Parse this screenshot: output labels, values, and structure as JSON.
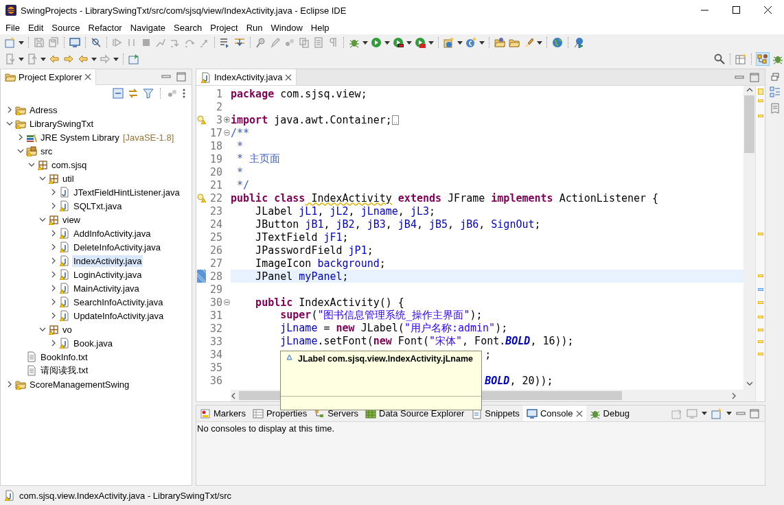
{
  "window": {
    "title": "SwingProjects - LibrarySwingTxt/src/com/sjsq/view/IndexActivity.java - Eclipse IDE"
  },
  "menu": [
    "File",
    "Edit",
    "Source",
    "Refactor",
    "Navigate",
    "Search",
    "Project",
    "Run",
    "Window",
    "Help"
  ],
  "explorer": {
    "title": "Project Explorer",
    "tree": [
      {
        "label": "Adress",
        "kind": "project",
        "warning": true,
        "expanded": false,
        "selected": false
      },
      {
        "label": "LibrarySwingTxt",
        "kind": "project",
        "warning": true,
        "expanded": true,
        "selected": false,
        "children": [
          {
            "label": "JRE System Library",
            "decoration": "[JavaSE-1.8]",
            "kind": "library",
            "warning": false,
            "expanded": false,
            "selected": false
          },
          {
            "label": "src",
            "kind": "source",
            "warning": true,
            "expanded": true,
            "selected": false,
            "children": [
              {
                "label": "com.sjsq",
                "kind": "package",
                "warning": true,
                "expanded": true,
                "selected": false,
                "children": [
                  {
                    "label": "util",
                    "kind": "package",
                    "warning": true,
                    "expanded": true,
                    "selected": false,
                    "children": [
                      {
                        "label": "JTextFieldHintListener.java",
                        "kind": "java",
                        "warning": false,
                        "expanded": false,
                        "selected": false
                      },
                      {
                        "label": "SQLTxt.java",
                        "kind": "java",
                        "warning": true,
                        "expanded": false,
                        "selected": false
                      }
                    ]
                  },
                  {
                    "label": "view",
                    "kind": "package",
                    "warning": true,
                    "expanded": true,
                    "selected": false,
                    "children": [
                      {
                        "label": "AddInfoActivity.java",
                        "kind": "java",
                        "warning": true,
                        "expanded": false,
                        "selected": false
                      },
                      {
                        "label": "DeleteInfoActivity.java",
                        "kind": "java",
                        "warning": true,
                        "expanded": false,
                        "selected": false
                      },
                      {
                        "label": "IndexActivity.java",
                        "kind": "java",
                        "warning": true,
                        "expanded": false,
                        "selected": true
                      },
                      {
                        "label": "LoginActivity.java",
                        "kind": "java",
                        "warning": true,
                        "expanded": false,
                        "selected": false
                      },
                      {
                        "label": "MainActivity.java",
                        "kind": "java",
                        "warning": true,
                        "expanded": false,
                        "selected": false
                      },
                      {
                        "label": "SearchInfoActivity.java",
                        "kind": "java",
                        "warning": true,
                        "expanded": false,
                        "selected": false
                      },
                      {
                        "label": "UpdateInfoActivity.java",
                        "kind": "java",
                        "warning": true,
                        "expanded": false,
                        "selected": false
                      }
                    ]
                  },
                  {
                    "label": "vo",
                    "kind": "package",
                    "warning": true,
                    "expanded": true,
                    "selected": false,
                    "children": [
                      {
                        "label": "Book.java",
                        "kind": "java",
                        "warning": true,
                        "expanded": false,
                        "selected": false
                      }
                    ]
                  }
                ]
              }
            ]
          },
          {
            "label": "BookInfo.txt",
            "kind": "text",
            "warning": false,
            "selected": false
          },
          {
            "label": "请阅读我.txt",
            "kind": "text",
            "warning": false,
            "selected": false
          }
        ]
      },
      {
        "label": "ScoreManagementSwing",
        "kind": "project",
        "warning": true,
        "expanded": false,
        "selected": false
      }
    ]
  },
  "editor": {
    "tab": {
      "title": "IndexActivity.java"
    },
    "lines": [
      {
        "n": "1",
        "tokens": [
          {
            "kind": "kw",
            "text": "package"
          },
          {
            "kind": "plain",
            "text": " com.sjsq.view;"
          }
        ]
      },
      {
        "n": "2"
      },
      {
        "n": "3",
        "warning": true,
        "folded": true,
        "tokens": [
          {
            "kind": "kw",
            "text": "import"
          },
          {
            "kind": "plain",
            "text": " java.awt.Container;"
          }
        ]
      },
      {
        "n": "17",
        "folded": false,
        "tokens": [
          {
            "kind": "comment",
            "text": "/**"
          }
        ]
      },
      {
        "n": "18",
        "tokens": [
          {
            "kind": "comment",
            "text": " *"
          }
        ]
      },
      {
        "n": "19",
        "tokens": [
          {
            "kind": "comment",
            "text": " * 主页面"
          }
        ]
      },
      {
        "n": "20",
        "tokens": [
          {
            "kind": "comment",
            "text": " *"
          }
        ]
      },
      {
        "n": "21",
        "tokens": [
          {
            "kind": "comment",
            "text": " */"
          }
        ]
      },
      {
        "n": "22",
        "warning": true,
        "tokens": [
          {
            "kind": "kw",
            "text": "public"
          },
          {
            "kind": "kw",
            "text": " class"
          },
          {
            "kind": "warn",
            "text": " IndexActivity"
          },
          {
            "kind": "kw",
            "text": " extends"
          },
          {
            "kind": "plain",
            "text": " JFrame "
          },
          {
            "kind": "kw",
            "text": "implements"
          },
          {
            "kind": "plain",
            "text": " ActionListener {"
          }
        ]
      },
      {
        "n": "23",
        "tokens": [
          {
            "kind": "plain",
            "text": "    JLabel "
          },
          {
            "kind": "field",
            "text": "jL1"
          },
          {
            "kind": "plain",
            "text": ", "
          },
          {
            "kind": "field",
            "text": "jL2"
          },
          {
            "kind": "plain",
            "text": ", "
          },
          {
            "kind": "field",
            "text": "jLname"
          },
          {
            "kind": "plain",
            "text": ", "
          },
          {
            "kind": "field",
            "text": "jL3"
          },
          {
            "kind": "plain",
            "text": ";"
          }
        ]
      },
      {
        "n": "24",
        "tokens": [
          {
            "kind": "plain",
            "text": "    JButton "
          },
          {
            "kind": "field",
            "text": "jB1"
          },
          {
            "kind": "plain",
            "text": ", "
          },
          {
            "kind": "field",
            "text": "jB2"
          },
          {
            "kind": "plain",
            "text": ", "
          },
          {
            "kind": "field",
            "text": "jB3"
          },
          {
            "kind": "plain",
            "text": ", "
          },
          {
            "kind": "field",
            "text": "jB4"
          },
          {
            "kind": "plain",
            "text": ", "
          },
          {
            "kind": "field",
            "text": "jB5"
          },
          {
            "kind": "plain",
            "text": ", "
          },
          {
            "kind": "field",
            "text": "jB6"
          },
          {
            "kind": "plain",
            "text": ", "
          },
          {
            "kind": "field",
            "text": "SignOut"
          },
          {
            "kind": "plain",
            "text": ";"
          }
        ]
      },
      {
        "n": "25",
        "tokens": [
          {
            "kind": "plain",
            "text": "    JTextField "
          },
          {
            "kind": "field",
            "text": "jF1"
          },
          {
            "kind": "plain",
            "text": ";"
          }
        ]
      },
      {
        "n": "26",
        "tokens": [
          {
            "kind": "plain",
            "text": "    JPasswordField "
          },
          {
            "kind": "field",
            "text": "jP1"
          },
          {
            "kind": "plain",
            "text": ";"
          }
        ]
      },
      {
        "n": "27",
        "tokens": [
          {
            "kind": "plain",
            "text": "    ImageIcon "
          },
          {
            "kind": "field",
            "text": "background"
          },
          {
            "kind": "plain",
            "text": ";"
          }
        ]
      },
      {
        "n": "28",
        "current": true,
        "tokens": [
          {
            "kind": "plain",
            "text": "    JPanel "
          },
          {
            "kind": "field",
            "text": "myPanel"
          },
          {
            "kind": "plain",
            "text": ";"
          }
        ]
      },
      {
        "n": "29"
      },
      {
        "n": "30",
        "folded": false,
        "tokens": [
          {
            "kind": "kw",
            "text": "    public"
          },
          {
            "kind": "plain",
            "text": " IndexActivity() {"
          }
        ]
      },
      {
        "n": "31",
        "tokens": [
          {
            "kind": "kw",
            "text": "        super"
          },
          {
            "kind": "plain",
            "text": "("
          },
          {
            "kind": "string",
            "text": "\"图书信息管理系统_操作主界面\""
          },
          {
            "kind": "plain",
            "text": ");"
          }
        ]
      },
      {
        "n": "32",
        "tokens": [
          {
            "kind": "field",
            "text": "        jLname"
          },
          {
            "kind": "plain",
            "text": " = "
          },
          {
            "kind": "kw",
            "text": "new"
          },
          {
            "kind": "plain",
            "text": " JLabel("
          },
          {
            "kind": "string",
            "text": "\"用户名称:admin\""
          },
          {
            "kind": "plain",
            "text": ");"
          }
        ]
      },
      {
        "n": "33",
        "tokens": [
          {
            "kind": "field",
            "text": "        jLname"
          },
          {
            "kind": "plain",
            "text": ".setFont("
          },
          {
            "kind": "kw",
            "text": "new"
          },
          {
            "kind": "plain",
            "text": " Font("
          },
          {
            "kind": "string",
            "text": "\"宋体\""
          },
          {
            "kind": "plain",
            "text": ", Font."
          },
          {
            "kind": "const",
            "text": "BOLD"
          },
          {
            "kind": "plain",
            "text": ", 16));"
          }
        ]
      },
      {
        "n": "34",
        "covered": true,
        "tokens": [
          {
            "kind": "plain",
            "text": ";"
          }
        ]
      },
      {
        "n": "35",
        "covered": true
      },
      {
        "n": "36",
        "covered": true,
        "tokens": [
          {
            "kind": "const",
            "text": "BOLD"
          },
          {
            "kind": "plain",
            "text": ", 20));"
          }
        ]
      }
    ],
    "hover": {
      "text": "JLabel com.sjsq.view.IndexActivity.jLname"
    }
  },
  "bottom": {
    "tabs": [
      {
        "label": "Markers",
        "selected": false
      },
      {
        "label": "Properties",
        "selected": false
      },
      {
        "label": "Servers",
        "selected": false
      },
      {
        "label": "Data Source Explorer",
        "selected": false
      },
      {
        "label": "Snippets",
        "selected": false
      },
      {
        "label": "Console",
        "selected": true
      },
      {
        "label": "Debug",
        "selected": false
      }
    ],
    "message": "No consoles to display at this time."
  },
  "status_bar": {
    "text": "com.sjsq.view.IndexActivity.java - LibrarySwingTxt/src"
  }
}
